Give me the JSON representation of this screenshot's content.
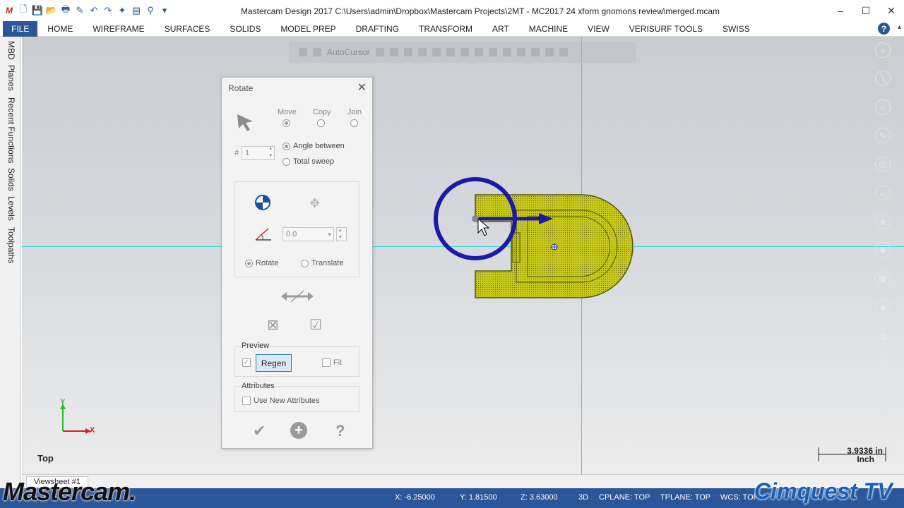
{
  "window": {
    "title": "Mastercam Design 2017  C:\\Users\\admin\\Dropbox\\Mastercam Projects\\2MT - MC2017 24 xform gnomons review\\merged.mcam",
    "minimize": "–",
    "maximize": "☐",
    "close": "✕"
  },
  "ribbon": {
    "tabs": [
      "FILE",
      "HOME",
      "WIREFRAME",
      "SURFACES",
      "SOLIDS",
      "MODEL PREP",
      "DRAFTING",
      "TRANSFORM",
      "ART",
      "MACHINE",
      "VIEW",
      "VERISURF TOOLS",
      "SWISS"
    ],
    "help": "?"
  },
  "left_tabs": [
    "MBD",
    "Planes",
    "Recent Functions",
    "Solids",
    "Levels",
    "Toolpaths"
  ],
  "toolbar": {
    "autocursor_label": "AutoCursor"
  },
  "viewport": {
    "view_name": "Top",
    "scale_value": "3.9336 in",
    "scale_unit": "Inch",
    "gnomon_y": "Y",
    "gnomon_x": "X"
  },
  "sheet": {
    "tab_label": "Viewsheet #1"
  },
  "rotate_dialog": {
    "title": "Rotate",
    "close": "✕",
    "modes": [
      "Move",
      "Copy",
      "Join"
    ],
    "selected_mode": "Move",
    "instances_symbol": "#",
    "instances_value": "1",
    "angle_options": [
      "Angle between",
      "Total sweep"
    ],
    "selected_angle_option": "Angle between",
    "angle_value": "0.0",
    "method_options": [
      "Rotate",
      "Translate"
    ],
    "selected_method": "Rotate",
    "preview_label": "Preview",
    "regen_label": "Regen",
    "fit_label": "Fit",
    "attributes_label": "Attributes",
    "use_new_attributes_label": "Use New Attributes"
  },
  "status": {
    "x": "X:   -6.25000",
    "y": "Y:   1.81500",
    "z": "Z:   3.63000",
    "mode": "3D",
    "cplane": "CPLANE: TOP",
    "tplane": "TPLANE: TOP",
    "wcs": "WCS: TOP"
  },
  "branding": {
    "left": "Mastercam.",
    "right": "Cimquest TV"
  },
  "colors": {
    "accent": "#2b579a",
    "crosshair": "#37d6df",
    "part": "#c8c81e",
    "gnomon_ring": "#1a1aa8"
  }
}
